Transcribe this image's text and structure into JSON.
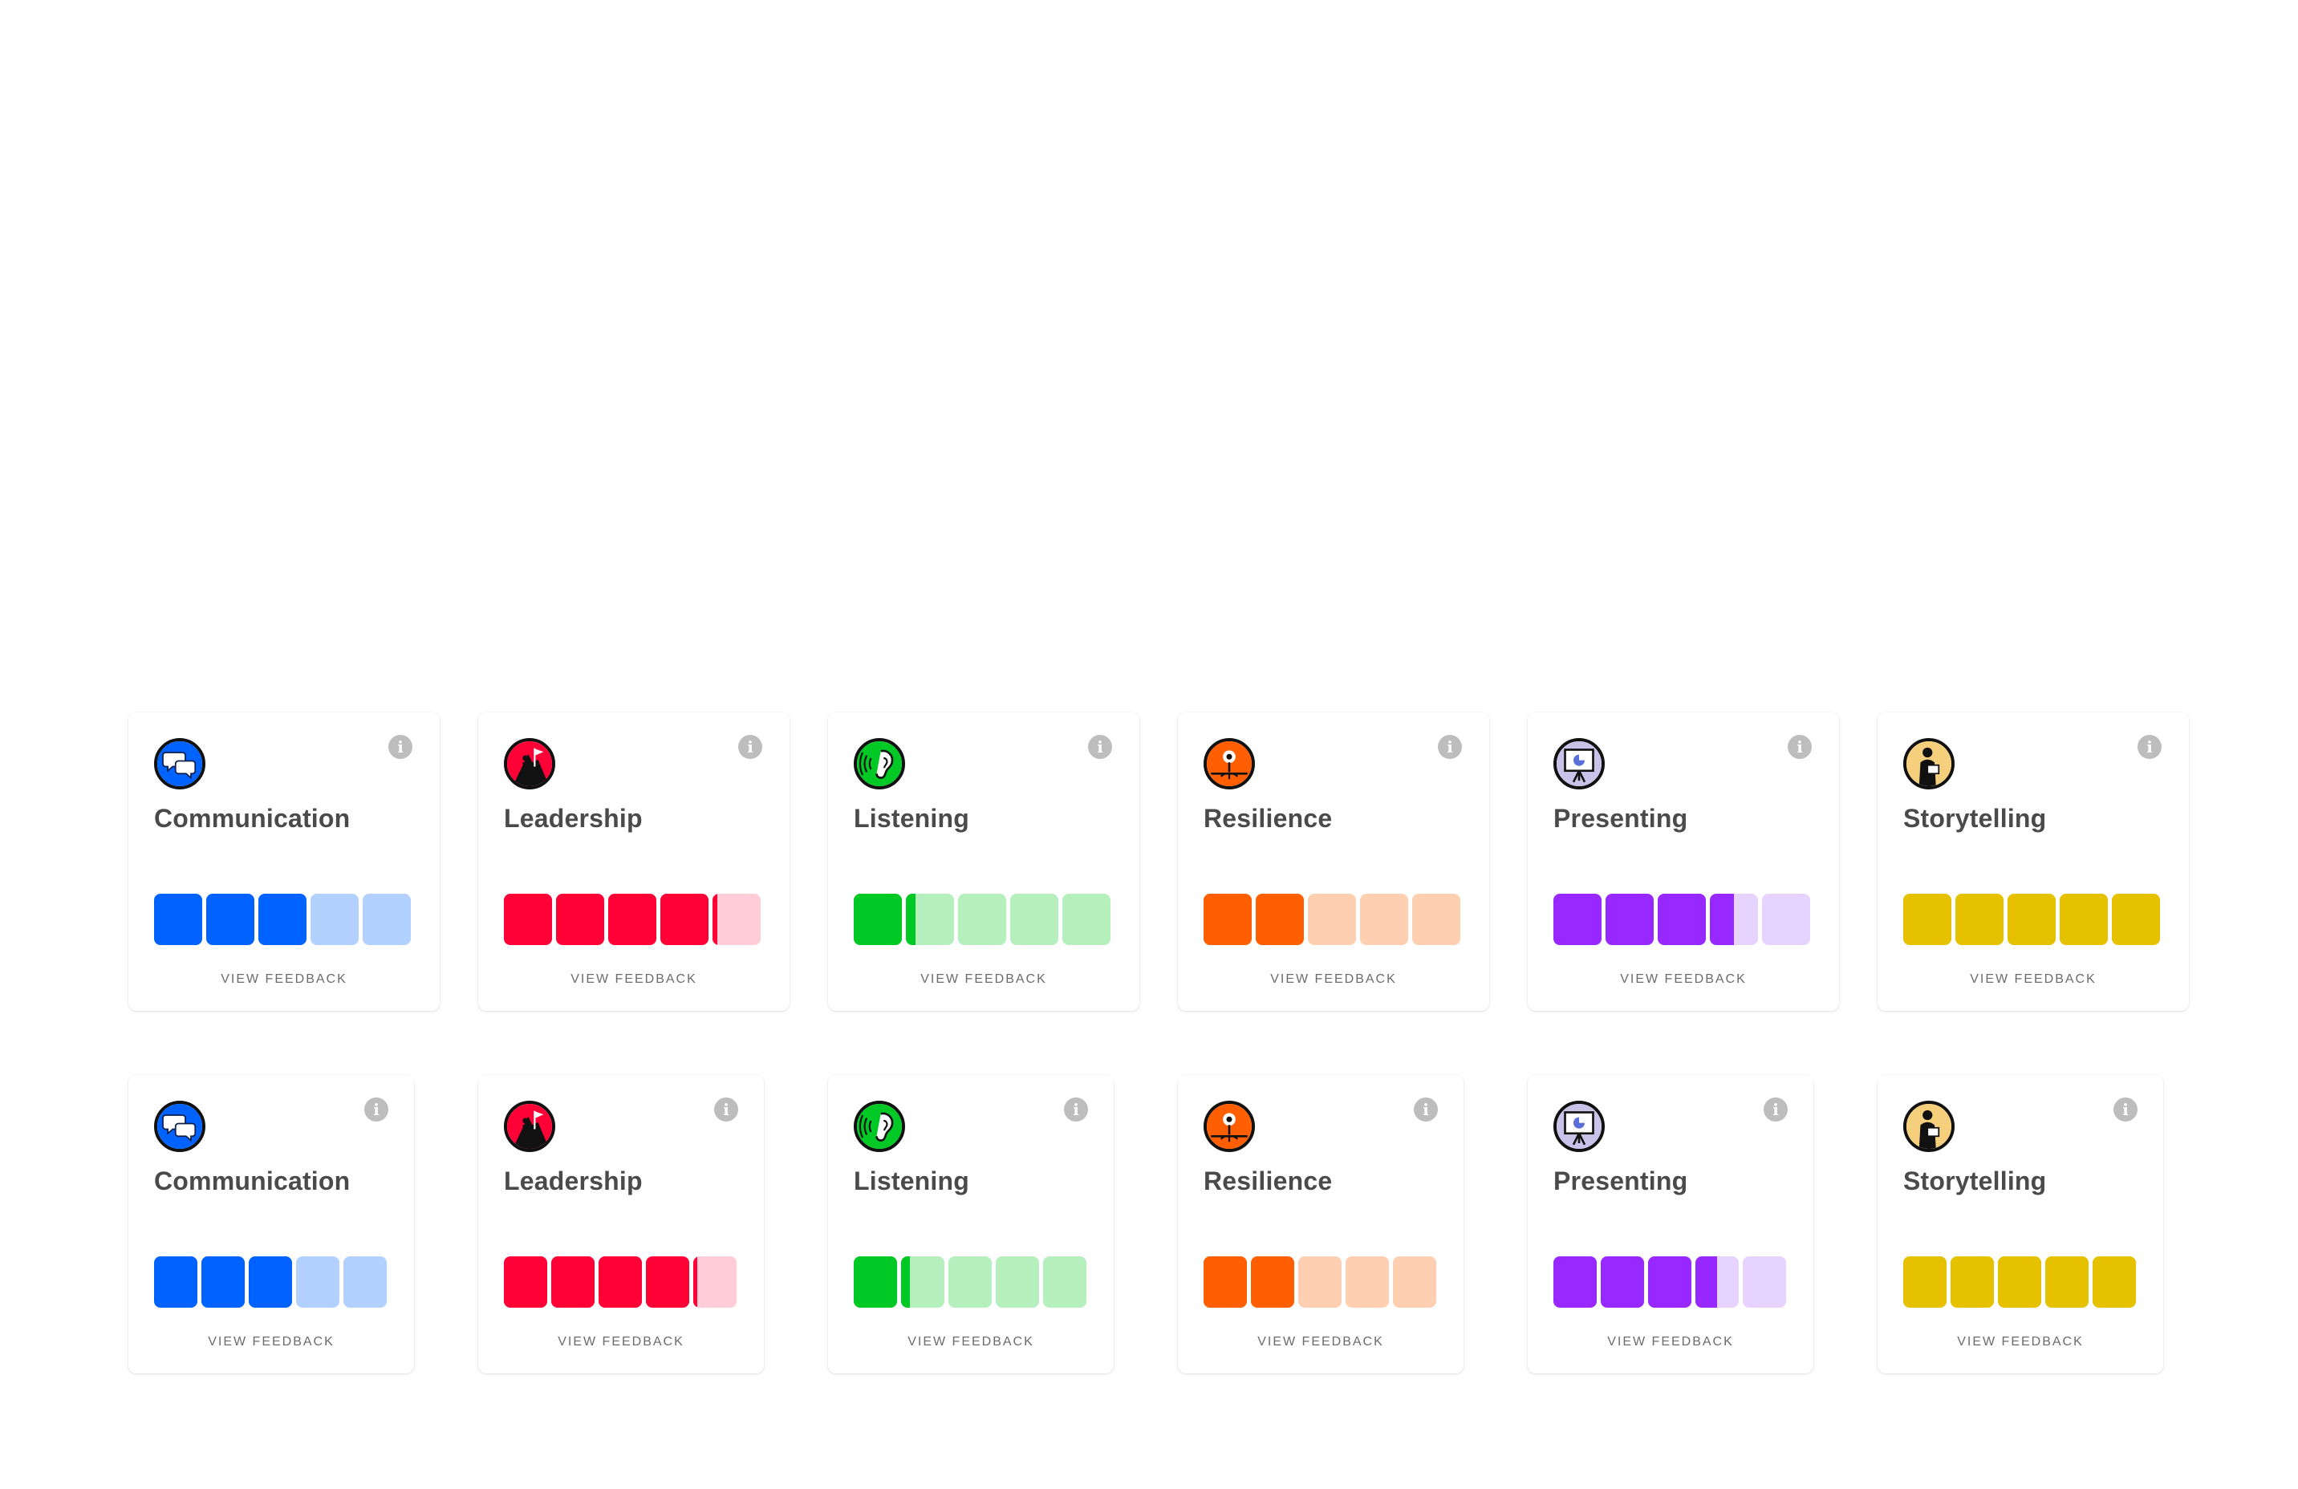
{
  "view_feedback_label": "VIEW FEEDBACK",
  "info_glyph": "i",
  "skills": [
    {
      "key": "communication",
      "name": "Communication",
      "icon": "speech-bubbles-icon",
      "color": "#0063ff",
      "light": "#b3d1ff",
      "level": 3.0
    },
    {
      "key": "leadership",
      "name": "Leadership",
      "icon": "flag-climber-icon",
      "color": "#ff0037",
      "light": "#ffccd8",
      "level": 4.1
    },
    {
      "key": "listening",
      "name": "Listening",
      "icon": "ear-icon",
      "color": "#00c824",
      "light": "#b4efbd",
      "level": 1.2
    },
    {
      "key": "resilience",
      "name": "Resilience",
      "icon": "sprout-icon",
      "color": "#ff5f00",
      "light": "#ffcfb2",
      "level": 2.0
    },
    {
      "key": "presenting",
      "name": "Presenting",
      "icon": "presentation-board-icon",
      "color": "#9728ff",
      "light": "#e6d3ff",
      "level": 3.5
    },
    {
      "key": "storytelling",
      "name": "Storytelling",
      "icon": "storyteller-icon",
      "color": "#e6c100",
      "light": "#f8e8a0",
      "level": 5.0
    }
  ],
  "rows": [
    {
      "name": "row-1"
    },
    {
      "name": "row-2"
    }
  ]
}
